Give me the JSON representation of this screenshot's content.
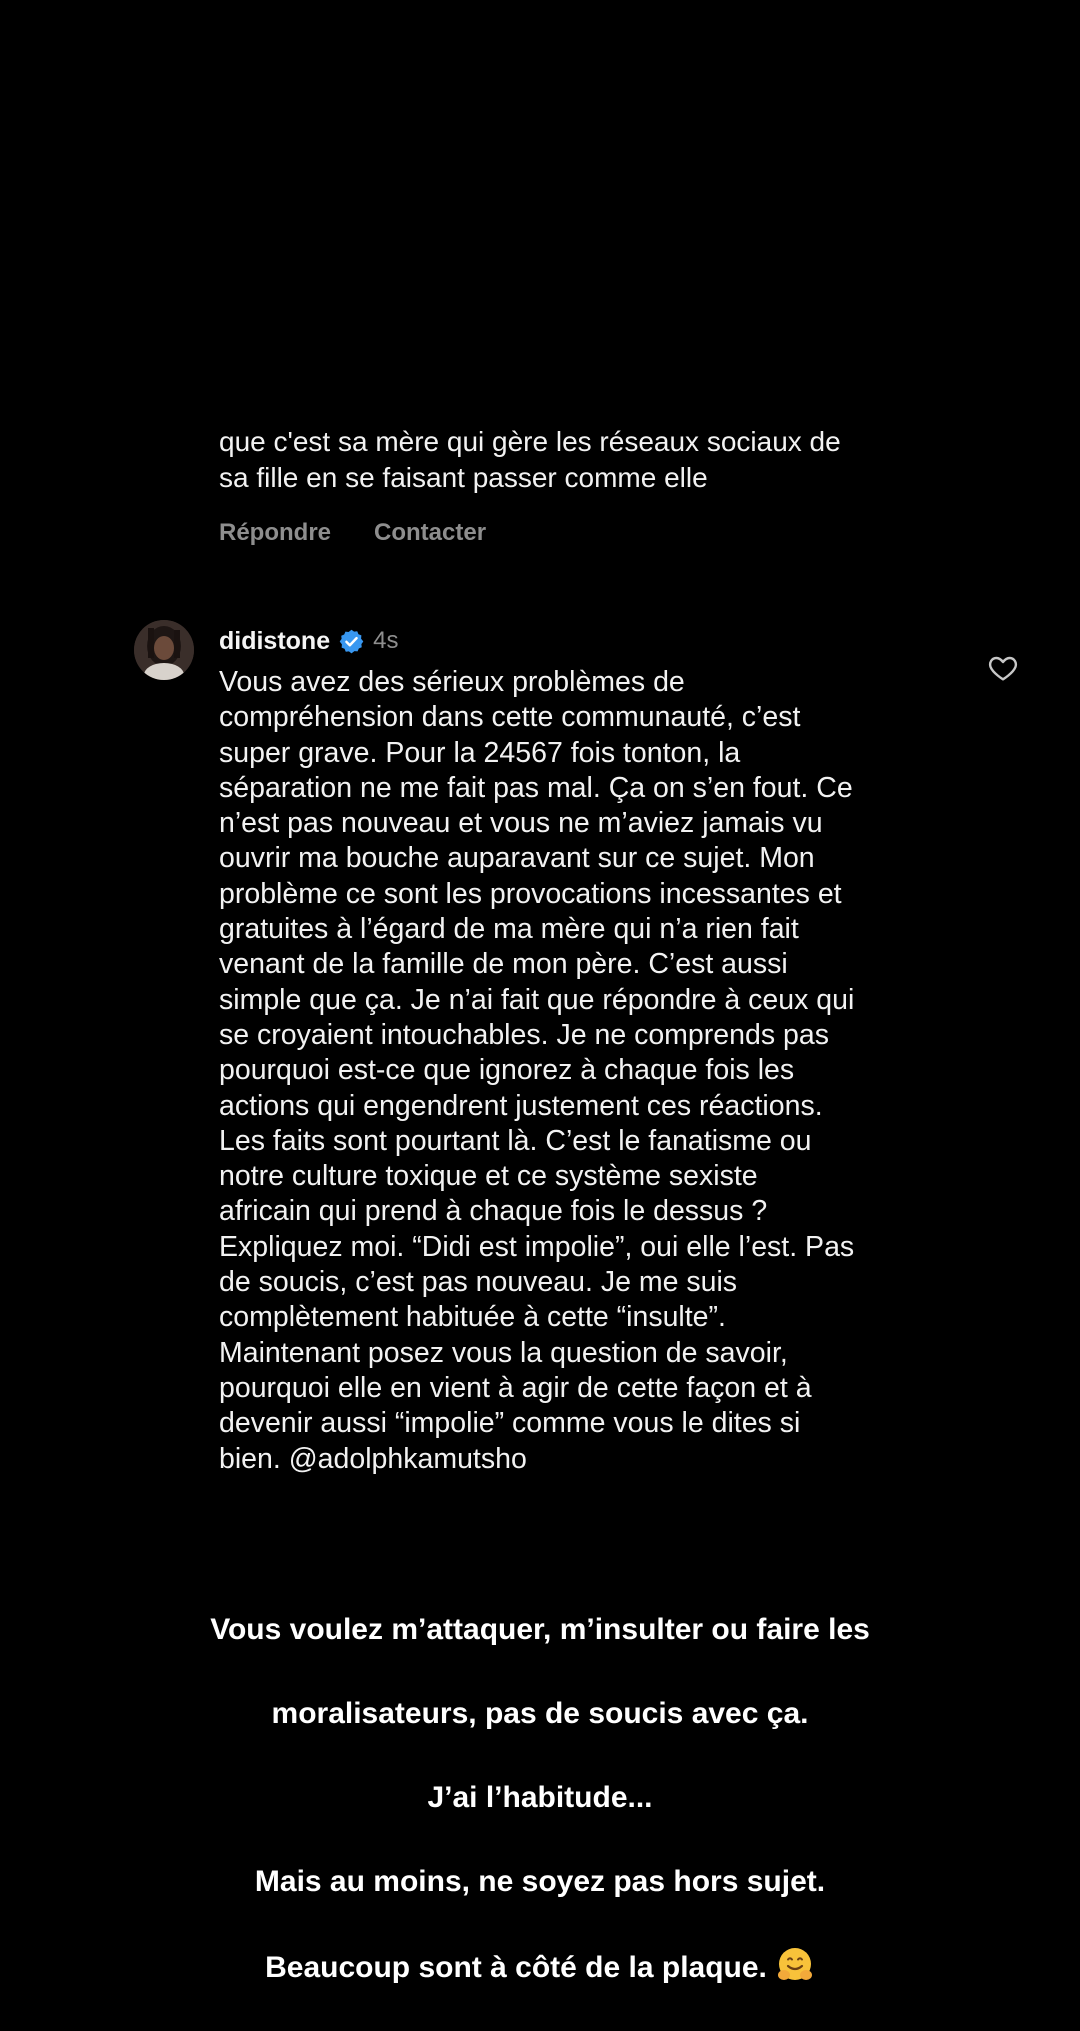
{
  "previous_comment": {
    "text": "que c'est sa mère qui gère les réseaux sociaux de\nsa fille en se faisant passer comme elle",
    "reply_label": "Répondre",
    "contact_label": "Contacter"
  },
  "comment": {
    "username": "didistone",
    "verified": true,
    "time": "4s",
    "text": "Vous avez des sérieux problèmes de\ncompréhension dans cette communauté, c’est\nsuper grave. Pour la 24567 fois tonton, la\nséparation ne me fait pas mal. Ça on s’en fout. Ce\nn’est pas nouveau et vous ne m’aviez jamais vu\nouvrir ma bouche auparavant sur ce sujet. Mon\nproblème ce sont les provocations incessantes et\ngratuites à l’égard de ma mère qui n’a rien fait\nvenant de la famille de mon père. C’est aussi\nsimple que ça. Je n’ai fait que répondre à ceux qui\nse croyaient intouchables. Je ne comprends pas\npourquoi est-ce que ignorez à chaque fois les\nactions qui engendrent justement ces réactions.\nLes faits sont pourtant là. C’est le fanatisme ou\nnotre culture toxique et ce système sexiste\nafricain qui prend à chaque fois le dessus ?\nExpliquez moi. “Didi est impolie”, oui elle l’est. Pas\nde soucis, c’est pas nouveau. Je me suis\ncomplètement habituée à cette “insulte”.\nMaintenant posez vous la question de savoir,\npourquoi elle en vient à agir de cette façon et à\ndevenir aussi “impolie” comme vous le dites si\nbien. @adolphkamutsho"
  },
  "caption": {
    "lines": [
      "Vous voulez m’attaquer, m’insulter ou faire les",
      "moralisateurs, pas de soucis avec ça.",
      "J’ai l’habitude...",
      "Mais au moins, ne soyez pas hors sujet.",
      "Beaucoup sont à côté de la plaque."
    ],
    "emoji": "hugging-face-icon"
  },
  "colors": {
    "background": "#000000",
    "text": "#f2f2f2",
    "muted": "#8e8e8e",
    "verified_blue": "#3897f0"
  }
}
